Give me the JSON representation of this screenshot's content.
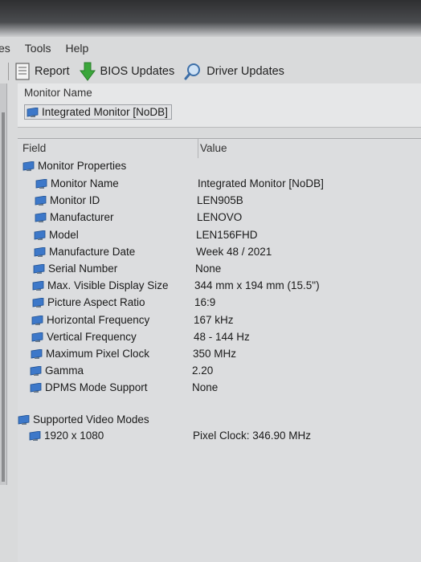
{
  "menu": [
    "es",
    "Tools",
    "Help"
  ],
  "toolbar": {
    "report_label": "Report",
    "bios_label": "BIOS Updates",
    "driver_label": "Driver Updates"
  },
  "info_panel": {
    "label": "Monitor Name",
    "value": "Integrated Monitor [NoDB]"
  },
  "grid": {
    "col_field": "Field",
    "col_value": "Value",
    "section1": "Monitor Properties",
    "properties": [
      {
        "field": "Monitor Name",
        "value": "Integrated Monitor [NoDB]"
      },
      {
        "field": "Monitor ID",
        "value": "LEN905B"
      },
      {
        "field": "Manufacturer",
        "value": "LENOVO"
      },
      {
        "field": "Model",
        "value": "LEN156FHD"
      },
      {
        "field": "Manufacture Date",
        "value": "Week 48 / 2021"
      },
      {
        "field": "Serial Number",
        "value": "None"
      },
      {
        "field": "Max. Visible Display Size",
        "value": "344 mm x 194 mm (15.5\")"
      },
      {
        "field": "Picture Aspect Ratio",
        "value": "16:9"
      },
      {
        "field": "Horizontal Frequency",
        "value": "167 kHz"
      },
      {
        "field": "Vertical Frequency",
        "value": "48 - 144 Hz"
      },
      {
        "field": "Maximum Pixel Clock",
        "value": "350 MHz"
      },
      {
        "field": "Gamma",
        "value": "2.20"
      },
      {
        "field": "DPMS Mode Support",
        "value": "None"
      }
    ],
    "section2": "Supported Video Modes",
    "modes": [
      {
        "field": "1920 x 1080",
        "value": "Pixel Clock: 346.90 MHz"
      }
    ]
  },
  "colors": {
    "background": "#d9dadb",
    "monitor_icon": "#3d78c9",
    "arrow_icon": "#3aa63a"
  }
}
